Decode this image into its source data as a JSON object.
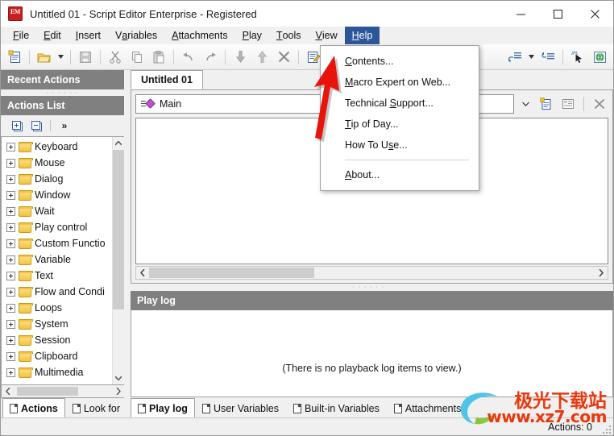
{
  "window": {
    "title": "Untitled 01 - Script Editor  Enterprise - Registered",
    "app_icon": "script-editor-icon",
    "controls": {
      "minimize": "minimize-icon",
      "maximize": "maximize-icon",
      "close": "close-icon"
    }
  },
  "menubar": {
    "items": [
      {
        "label": "File",
        "mnemonic": "F",
        "active": false
      },
      {
        "label": "Edit",
        "mnemonic": "E",
        "active": false
      },
      {
        "label": "Insert",
        "mnemonic": "I",
        "active": false
      },
      {
        "label": "Variables",
        "mnemonic": "a",
        "active": false
      },
      {
        "label": "Attachments",
        "mnemonic": "A",
        "active": false
      },
      {
        "label": "Play",
        "mnemonic": "P",
        "active": false
      },
      {
        "label": "Tools",
        "mnemonic": "T",
        "active": false
      },
      {
        "label": "View",
        "mnemonic": "V",
        "active": false
      },
      {
        "label": "Help",
        "mnemonic": "H",
        "active": true
      }
    ]
  },
  "help_menu": {
    "open": true,
    "items": [
      {
        "label": "Contents...",
        "mnemonic": "C"
      },
      {
        "label": "Macro Expert on Web...",
        "mnemonic": "M"
      },
      {
        "label": "Technical Support...",
        "mnemonic": "S"
      },
      {
        "label": "Tip of Day...",
        "mnemonic": "T"
      },
      {
        "label": "How To Use...",
        "mnemonic": "s"
      },
      {
        "separator": true
      },
      {
        "label": "About...",
        "mnemonic": "A"
      }
    ]
  },
  "toolbar": {
    "buttons": [
      {
        "name": "new-script-icon"
      },
      {
        "name": "open-icon",
        "has_caret": true
      },
      {
        "name": "save-icon"
      },
      {
        "name": "cut-icon"
      },
      {
        "name": "copy-icon"
      },
      {
        "name": "paste-icon"
      },
      {
        "name": "undo-icon"
      },
      {
        "name": "redo-icon"
      },
      {
        "name": "move-down-icon"
      },
      {
        "name": "move-up-icon"
      },
      {
        "name": "delete-icon"
      },
      {
        "name": "edit-action-icon"
      },
      {
        "name": "comment-icon"
      },
      {
        "name": "record-icon",
        "has_caret": true
      },
      {
        "name": "step-icon"
      },
      {
        "name": "capture-icon"
      },
      {
        "name": "web-icon"
      }
    ]
  },
  "left_pane": {
    "recent_actions_header": "Recent Actions",
    "actions_list_header": "Actions List",
    "tree_toolbar": [
      {
        "name": "expand-all-icon"
      },
      {
        "name": "collapse-all-icon"
      },
      {
        "name": "more-chevron-icon",
        "glyph": "»"
      }
    ],
    "tree_items": [
      "Keyboard",
      "Mouse",
      "Dialog",
      "Window",
      "Wait",
      "Play control",
      "Custom Functio",
      "Variable",
      "Text",
      "Flow and Condi",
      "Loops",
      "System",
      "Session",
      "Clipboard",
      "Multimedia"
    ],
    "tabs": [
      {
        "label": "Actions",
        "selected": true
      },
      {
        "label": "Look for",
        "selected": false
      }
    ]
  },
  "editor": {
    "doc_tab": "Untitled 01",
    "main_node": "Main",
    "main_node_icon": "script-node-icon",
    "buttons": [
      {
        "name": "combo-dropdown-arrow"
      },
      {
        "name": "new-block-icon"
      },
      {
        "name": "properties-icon"
      },
      {
        "name": "close-block-icon"
      }
    ]
  },
  "log_pane": {
    "header": "Play log",
    "empty_message": "(There is no playback log items to view.)",
    "tabs": [
      {
        "label": "Play log",
        "selected": true
      },
      {
        "label": "User Variables",
        "selected": false
      },
      {
        "label": "Built-in Variables",
        "selected": false
      },
      {
        "label": "Attachments",
        "selected": false
      }
    ]
  },
  "statusbar": {
    "actions_count": "Actions: 0"
  },
  "watermark": {
    "line1": "极光下载站",
    "line2": "www.xz7.com"
  },
  "annotation": {
    "arrow": "red-arrow-pointing-up-right"
  },
  "colors": {
    "menu_highlight": "#2b579a",
    "pane_header": "#808080",
    "folder": "#f3c23e",
    "annotation_red": "#e8140b",
    "watermark_red": "#e8380d"
  }
}
